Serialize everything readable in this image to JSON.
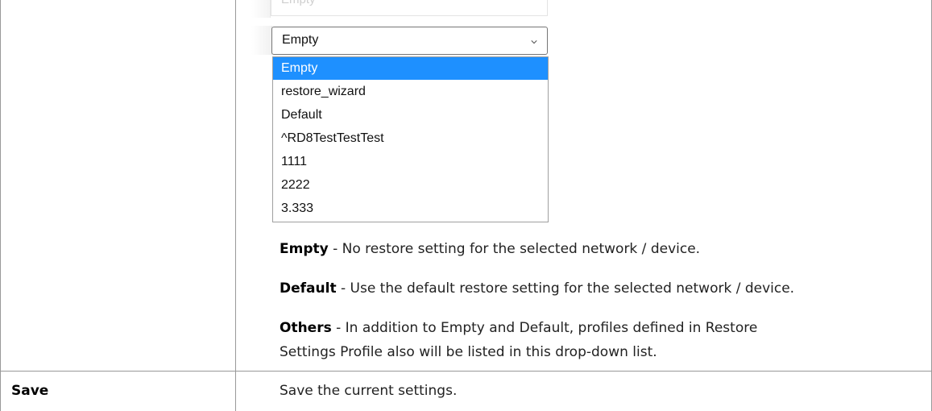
{
  "previous_select": {
    "value": "Empty"
  },
  "restore_select": {
    "value": "Empty",
    "options": [
      "Empty",
      "restore_wizard",
      "Default",
      "^RD8TestTestTest",
      "1111",
      "2222",
      "3.333"
    ],
    "selected_index": 0
  },
  "descriptions": [
    {
      "term": "Empty",
      "text": " - No restore setting for the selected network / device."
    },
    {
      "term": "Default",
      "text": " - Use the default restore setting for the selected network / device."
    },
    {
      "term": "Others",
      "text": " - In addition to Empty and Default, profiles defined in Restore",
      "text_line2": "Settings Profile also will be listed in this drop-down list."
    }
  ],
  "save_row": {
    "label": "Save",
    "description": "Save the current settings."
  }
}
